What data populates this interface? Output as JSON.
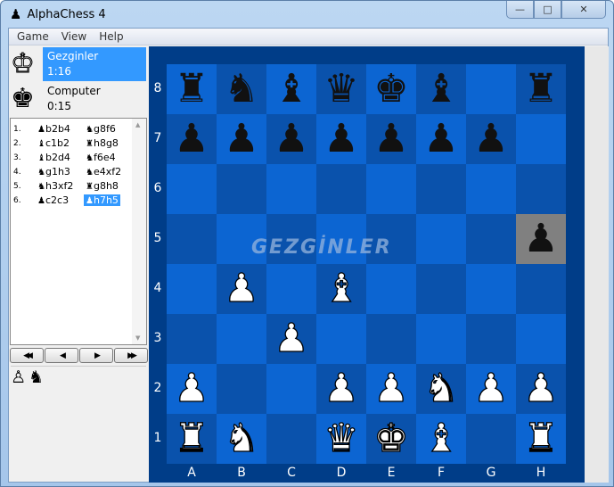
{
  "window": {
    "title": "AlphaChess 4",
    "icon": "chess-pawn-icon",
    "minimize": "—",
    "maximize": "□",
    "close": "✕"
  },
  "menu": [
    "Game",
    "View",
    "Help"
  ],
  "players": [
    {
      "name": "Gezginler",
      "time": "1:16",
      "king": "♔",
      "selected": true
    },
    {
      "name": "Computer",
      "time": "0:15",
      "king": "♚",
      "selected": false
    }
  ],
  "moves": [
    {
      "n": "1.",
      "w": "b2b4",
      "wp": "♟",
      "b": "g8f6",
      "bp": "♞"
    },
    {
      "n": "2.",
      "w": "c1b2",
      "wp": "♝",
      "b": "h8g8",
      "bp": "♜"
    },
    {
      "n": "3.",
      "w": "b2d4",
      "wp": "♝",
      "b": "f6e4",
      "bp": "♞"
    },
    {
      "n": "4.",
      "w": "g1h3",
      "wp": "♞",
      "b": "e4xf2",
      "bp": "♞"
    },
    {
      "n": "5.",
      "w": "h3xf2",
      "wp": "♞",
      "b": "g8h8",
      "bp": "♜"
    },
    {
      "n": "6.",
      "w": "c2c3",
      "wp": "♟",
      "b": "h7h5",
      "bp": "♟",
      "selected": true
    }
  ],
  "nav": [
    "◀◀",
    "◀",
    "▶",
    "▶▶"
  ],
  "captured": [
    {
      "glyph": "♙",
      "color": "white"
    },
    {
      "glyph": "♞",
      "color": "black"
    }
  ],
  "watermark": "GEZGİNLER",
  "files": [
    "A",
    "B",
    "C",
    "D",
    "E",
    "F",
    "G",
    "H"
  ],
  "ranks": [
    "8",
    "7",
    "6",
    "5",
    "4",
    "3",
    "2",
    "1"
  ],
  "highlight": "h5",
  "position": [
    "rnbqkb.r",
    "ppppppp.",
    "........",
    ".......p",
    ".P.B....",
    "..P.....",
    "P..PPNPP",
    "RN.QKB.R"
  ],
  "colors": {
    "light": "#0c65d2",
    "dark": "#0a52ac",
    "frame": "#003d88",
    "highlight": "#808080",
    "selection": "#3399ff"
  }
}
